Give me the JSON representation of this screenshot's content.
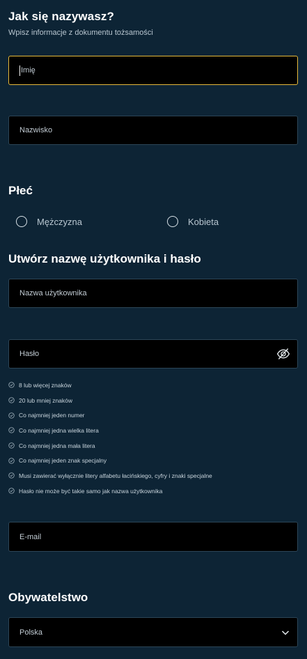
{
  "name_section": {
    "title": "Jak się nazywasz?",
    "subtitle": "Wpisz informacje z dokumentu tożsamości",
    "first_name_placeholder": "Imię",
    "last_name_placeholder": "Nazwisko"
  },
  "gender_section": {
    "title": "Płeć",
    "options": [
      "Mężczyzna",
      "Kobieta"
    ]
  },
  "account_section": {
    "title": "Utwórz nazwę użytkownika i hasło",
    "username_placeholder": "Nazwa użytkownika",
    "password_placeholder": "Hasło",
    "password_rules": [
      "8 lub więcej znaków",
      "20 lub mniej znaków",
      "Co najmniej jeden numer",
      "Co najmniej jedna wielka litera",
      "Co najmniej jedna mała litera",
      "Co najmniej jeden znak specjalny",
      "Musi zawierać wyłącznie litery alfabetu łacińskiego, cyfry i znaki specjalne",
      "Hasło nie może być takie samo jak nazwa użytkownika"
    ],
    "email_placeholder": "E-mail"
  },
  "citizenship_section": {
    "title": "Obywatelstwo",
    "selected": "Polska"
  },
  "icons": {
    "password_toggle": "eye-slash-icon",
    "rule_check": "check-circle-icon",
    "dropdown": "chevron-down-icon"
  },
  "colors": {
    "background": "#0d2435",
    "field_background": "#000000",
    "focus_border": "#e7b93a"
  }
}
